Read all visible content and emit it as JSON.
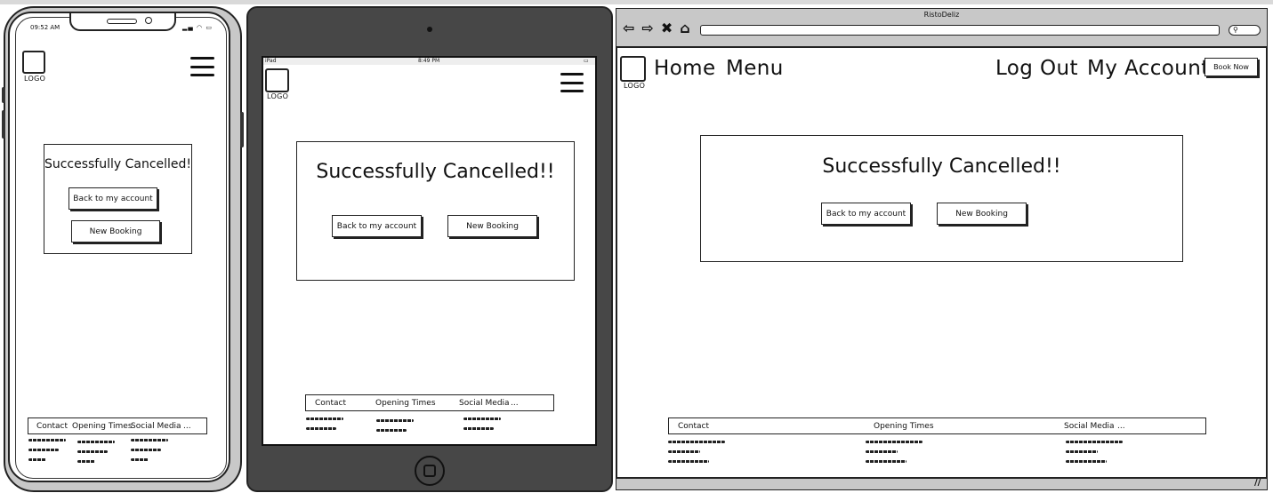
{
  "cancel_heading_phone": "Successfully Cancelled!",
  "cancel_heading": "Successfully Cancelled!!",
  "buttons": {
    "back": "Back to my account",
    "new_booking": "New Booking",
    "book_now": "Book Now"
  },
  "logo": "LOGO",
  "nav": {
    "home": "Home",
    "menu": "Menu",
    "logout": "Log Out",
    "account": "My Account"
  },
  "footer": {
    "contact": "Contact",
    "opening": "Opening Times",
    "social": "Social Media",
    "more": "..."
  },
  "phone_status": {
    "time": "09:52 AM"
  },
  "tablet_status": {
    "device": "iPad",
    "time": "8:49 PM"
  },
  "browser": {
    "title": "RistoDeliz",
    "nav_icons": [
      "back-arrow-icon",
      "forward-arrow-icon",
      "close-icon",
      "home-icon"
    ]
  }
}
